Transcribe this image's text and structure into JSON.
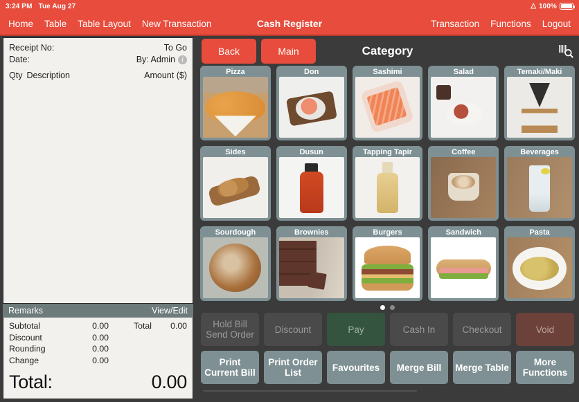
{
  "statusbar": {
    "time": "3:24 PM",
    "date": "Tue Aug 27",
    "wifi_icon": "wifi-icon",
    "battery_text": "100%",
    "battery_icon": "battery-icon"
  },
  "topnav": {
    "title": "Cash Register",
    "left_items": [
      {
        "label": "Home",
        "name": "nav-home"
      },
      {
        "label": "Table",
        "name": "nav-table"
      },
      {
        "label": "Table Layout",
        "name": "nav-table-layout"
      },
      {
        "label": "New Transaction",
        "name": "nav-new-transaction"
      }
    ],
    "right_items": [
      {
        "label": "Transaction",
        "name": "nav-transaction"
      },
      {
        "label": "Functions",
        "name": "nav-functions"
      },
      {
        "label": "Logout",
        "name": "nav-logout"
      }
    ]
  },
  "receipt": {
    "receipt_no_label": "Receipt No:",
    "receipt_no_value": "",
    "order_type": "To Go",
    "date_label": "Date:",
    "date_value": "",
    "cashier": "By: Admin",
    "info_icon": "info-icon",
    "info_glyph": "i",
    "col_qty": "Qty",
    "col_description": "Description",
    "col_amount": "Amount ($)",
    "remarks_label": "Remarks",
    "remarks_action": "View/Edit",
    "totals": [
      {
        "label": "Subtotal",
        "value": "0.00"
      },
      {
        "label": "Discount",
        "value": "0.00"
      },
      {
        "label": "Rounding",
        "value": "0.00"
      },
      {
        "label": "Change",
        "value": "0.00"
      }
    ],
    "total_side_label": "Total",
    "total_side_value": "0.00",
    "grand_label": "Total:",
    "grand_value": "0.00"
  },
  "category_header": {
    "back_label": "Back",
    "main_label": "Main",
    "title": "Category",
    "scan_icon": "barcode-search-icon"
  },
  "categories": [
    {
      "label": "Pizza",
      "name": "category-tile-pizza",
      "art": "ph-pizza"
    },
    {
      "label": "Don",
      "name": "category-tile-don",
      "art": "ph-don"
    },
    {
      "label": "Sashimi",
      "name": "category-tile-sashimi",
      "art": "ph-sashimi"
    },
    {
      "label": "Salad",
      "name": "category-tile-salad",
      "art": "ph-salad"
    },
    {
      "label": "Temaki/Maki",
      "name": "category-tile-temaki-maki",
      "art": "ph-temaki"
    },
    {
      "label": "Sides",
      "name": "category-tile-sides",
      "art": "ph-sides"
    },
    {
      "label": "Dusun",
      "name": "category-tile-dusun",
      "art": "ph-dusun"
    },
    {
      "label": "Tapping Tapir",
      "name": "category-tile-tapping-tapir",
      "art": "ph-tapir"
    },
    {
      "label": "Coffee",
      "name": "category-tile-coffee",
      "art": "ph-coffee"
    },
    {
      "label": "Beverages",
      "name": "category-tile-beverages",
      "art": "ph-bev"
    },
    {
      "label": "Sourdough",
      "name": "category-tile-sourdough",
      "art": "ph-sour"
    },
    {
      "label": "Brownies",
      "name": "category-tile-brownies",
      "art": "ph-brownie"
    },
    {
      "label": "Burgers",
      "name": "category-tile-burgers",
      "art": "ph-burger"
    },
    {
      "label": "Sandwich",
      "name": "category-tile-sandwich",
      "art": "ph-sandwich"
    },
    {
      "label": "Pasta",
      "name": "category-tile-pasta",
      "art": "ph-pasta"
    }
  ],
  "pagination": {
    "total_pages": 2,
    "current_page": 1
  },
  "actions_row1": [
    {
      "label": "Hold Bill\nSend Order",
      "name": "hold-bill-send-order-button",
      "style": "act-dark"
    },
    {
      "label": "Discount",
      "name": "discount-button",
      "style": "act-dark"
    },
    {
      "label": "Pay",
      "name": "pay-button",
      "style": "act-pay"
    },
    {
      "label": "Cash In",
      "name": "cash-in-button",
      "style": "act-dark"
    },
    {
      "label": "Checkout",
      "name": "checkout-button",
      "style": "act-dark"
    },
    {
      "label": "Void",
      "name": "void-button",
      "style": "act-void"
    }
  ],
  "actions_row2": [
    {
      "label": "Print\nCurrent Bill",
      "name": "print-current-bill-button",
      "style": "act-light"
    },
    {
      "label": "Print Order\nList",
      "name": "print-order-list-button",
      "style": "act-light"
    },
    {
      "label": "Favourites",
      "name": "favourites-button",
      "style": "act-light"
    },
    {
      "label": "Merge Bill",
      "name": "merge-bill-button",
      "style": "act-light"
    },
    {
      "label": "Merge Table",
      "name": "merge-table-button",
      "style": "act-light"
    },
    {
      "label": "More\nFunctions",
      "name": "more-functions-button",
      "style": "act-light"
    }
  ],
  "colors": {
    "brand_red": "#e74c3c",
    "panel_dark": "#3b3b3b",
    "tile_frame": "#7e9093",
    "pay_green": "#35543f",
    "void_red": "#6b413a",
    "paper": "#f2f1ed",
    "remarks_bar": "#6e7b7b"
  }
}
